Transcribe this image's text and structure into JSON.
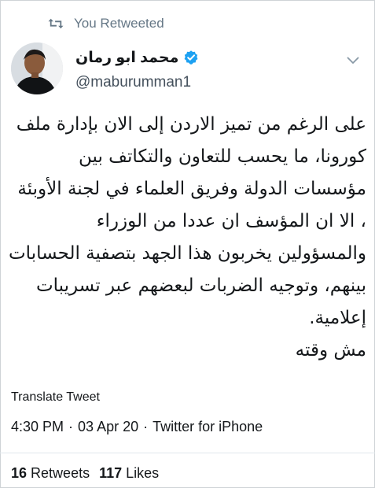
{
  "retweet": {
    "icon": "retweet-icon",
    "label": "You Retweeted"
  },
  "author": {
    "name": "محمد ابو رمان",
    "handle": "@maburumman1",
    "verified_icon": "verified-badge-icon",
    "verified_color": "#1da1f2"
  },
  "menu_icon": "chevron-down-icon",
  "tweet": {
    "text": "على الرغم من تميز الاردن إلى الان بإدارة ملف كورونا، ما يحسب للتعاون والتكاتف بين مؤسسات الدولة وفريق العلماء في لجنة الأوبئة ، الا ان المؤسف ان عددا من الوزراء والمسؤولين يخربون هذا الجهد بتصفية الحسابات بينهم، وتوجيه الضربات لبعضهم عبر تسريبات إعلامية.\nمش وقته"
  },
  "translate_label": "Translate Tweet",
  "meta": {
    "time": "4:30 PM",
    "date": "03 Apr 20",
    "source": "Twitter for iPhone",
    "separator": "·"
  },
  "stats": {
    "retweets_count": "16",
    "retweets_label": "Retweets",
    "likes_count": "117",
    "likes_label": "Likes"
  },
  "colors": {
    "text": "#14171a",
    "secondary": "#657786",
    "border": "#e1e8ed"
  }
}
